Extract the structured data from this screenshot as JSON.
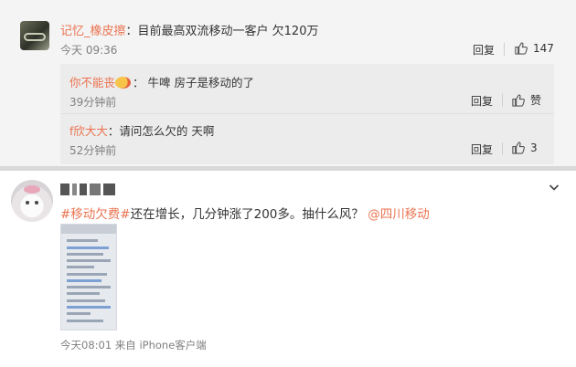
{
  "comment": {
    "username": "记忆_橡皮擦",
    "text": "：目前最高双流移动一客户 欠120万",
    "time": "今天 09:36",
    "reply_label": "回复",
    "likes": "147"
  },
  "replies": [
    {
      "username": "你不能丧",
      "text": "： 牛啤 房子是移动的了",
      "time": "39分钟前",
      "reply_label": "回复",
      "like_label": "赞"
    },
    {
      "username": "f欣大大",
      "text": "：请问怎么欠的   天啊",
      "time": "52分钟前",
      "reply_label": "回复",
      "like_label": "3"
    }
  ],
  "post": {
    "hashtag": "#移动欠费#",
    "text": "还在增长，几分钟涨了200多。抽什么风？",
    "mention": "@四川移动",
    "meta": "今天08:01 来自 iPhone客户端"
  },
  "icons": {
    "like": "thumbs-up-icon",
    "menu": "chevron-down-icon"
  },
  "colors": {
    "accent": "#eb7350",
    "panel_bg": "#f4f4f4"
  }
}
